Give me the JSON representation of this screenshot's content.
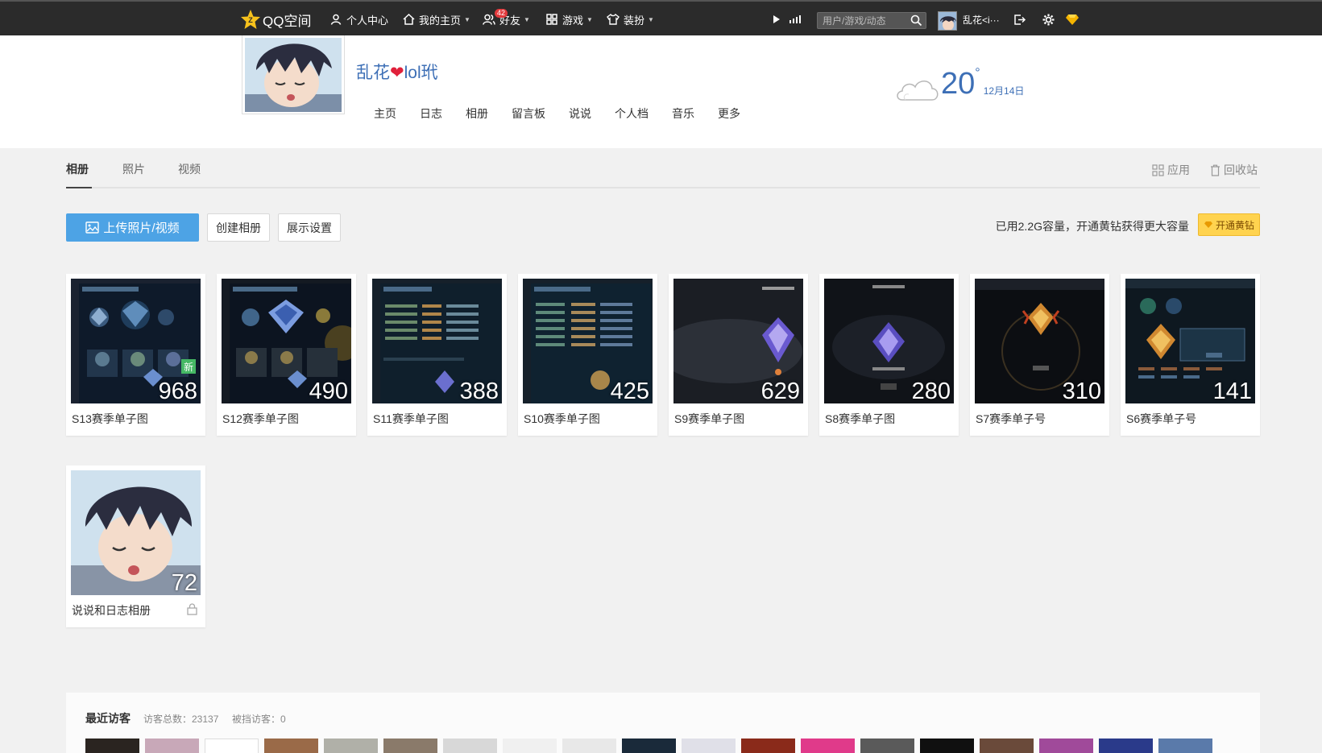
{
  "topbar": {
    "logo": "QQ空间",
    "items": [
      {
        "label": "个人中心"
      },
      {
        "label": "我的主页"
      },
      {
        "label": "好友"
      },
      {
        "label": "游戏"
      },
      {
        "label": "装扮"
      }
    ],
    "friend_badge": "42",
    "search_placeholder": "用户/游戏/动态",
    "user_name": "乱花<i···"
  },
  "profile": {
    "name_part1": "乱花",
    "name_heart": "❤",
    "name_part2": "lol玳",
    "nav": [
      "主页",
      "日志",
      "相册",
      "留言板",
      "说说",
      "个人档",
      "音乐",
      "更多"
    ],
    "weather": {
      "temp": "20",
      "deg": "°",
      "date": "12月14日"
    }
  },
  "tabs": {
    "items": [
      "相册",
      "照片",
      "视频"
    ],
    "active": 0,
    "right": [
      "应用",
      "回收站"
    ]
  },
  "toolbar": {
    "upload": "上传照片/视频",
    "create": "创建相册",
    "display": "展示设置",
    "storage": "已用2.2G容量，开通黄钻获得更大容量",
    "vip": "开通黄钻"
  },
  "albums": [
    {
      "title": "S13赛季单子图",
      "count": "968",
      "new": "新"
    },
    {
      "title": "S12赛季单子图",
      "count": "490"
    },
    {
      "title": "S11赛季单子图",
      "count": "388"
    },
    {
      "title": "S10赛季单子图",
      "count": "425"
    },
    {
      "title": "S9赛季单子图",
      "count": "629"
    },
    {
      "title": "S8赛季单子图",
      "count": "280"
    },
    {
      "title": "S7赛季单子号",
      "count": "310"
    },
    {
      "title": "S6赛季单子号",
      "count": "141"
    },
    {
      "title": "说说和日志相册",
      "count": "72",
      "locked": true
    }
  ],
  "visitors": {
    "title": "最近访客",
    "total": "访客总数：23137",
    "blocked": "被挡访客：0"
  },
  "colors": {
    "topbar": "#2b2b2b",
    "accent_blue": "#3d6fb6",
    "upload_blue": "#4da3e5",
    "vip_yellow": "#ffd34f",
    "new_green": "#45b864"
  }
}
